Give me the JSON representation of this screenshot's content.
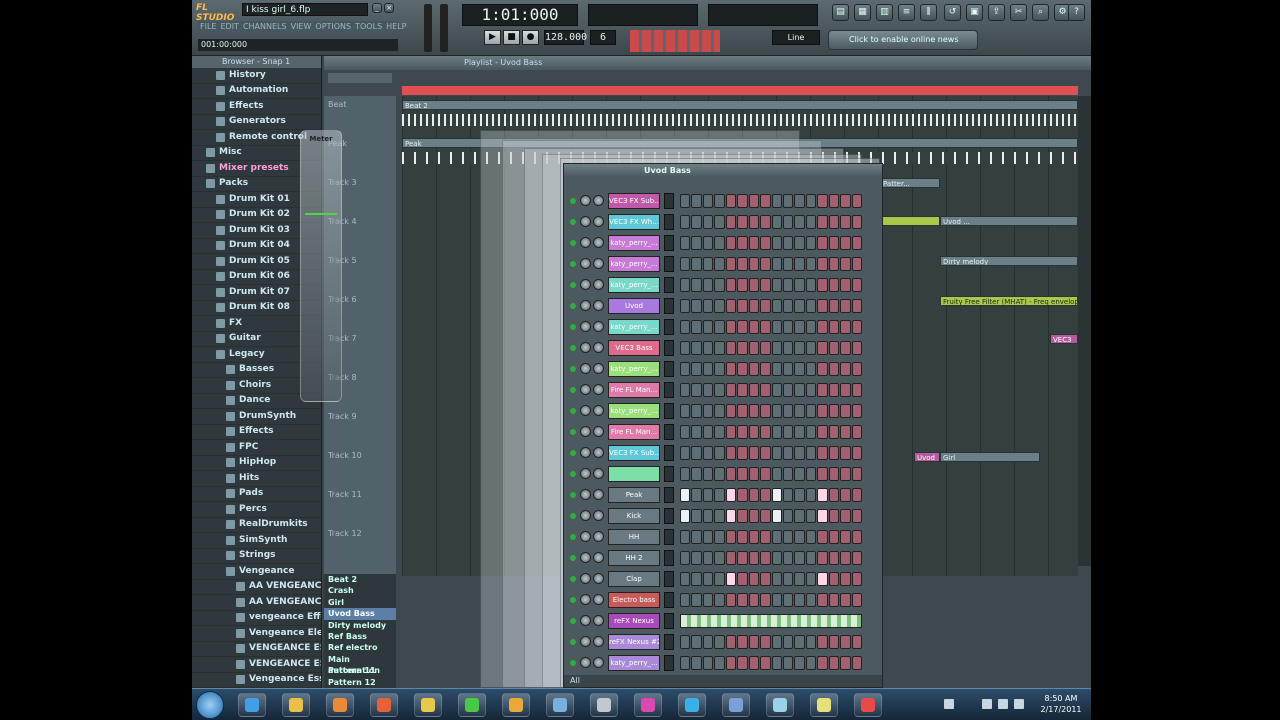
{
  "app": {
    "name": "FL STUDIO",
    "project_file": "I kiss girl_6.flp",
    "hint_time": "001:00:000",
    "menu": [
      "FILE",
      "EDIT",
      "CHANNELS",
      "VIEW",
      "OPTIONS",
      "TOOLS",
      "HELP"
    ],
    "song_time": "1:01:000",
    "tempo": "128.000",
    "pattern_number": "6",
    "snap": "Line",
    "news_label": "Click to enable online news"
  },
  "browser": {
    "title": "Browser - Snap 1",
    "items": [
      {
        "label": "History",
        "hl": false
      },
      {
        "label": "Automation",
        "hl": false
      },
      {
        "label": "Effects",
        "hl": false
      },
      {
        "label": "Generators",
        "hl": false
      },
      {
        "label": "Remote control",
        "hl": false
      },
      {
        "label": "Misc",
        "hl": false
      },
      {
        "label": "Mixer presets",
        "hl": true
      },
      {
        "label": "Packs",
        "hl": false
      },
      {
        "label": "Drum Kit 01",
        "hl": false
      },
      {
        "label": "Drum Kit 02",
        "hl": false
      },
      {
        "label": "Drum Kit 03",
        "hl": false
      },
      {
        "label": "Drum Kit 04",
        "hl": false
      },
      {
        "label": "Drum Kit 05",
        "hl": false
      },
      {
        "label": "Drum Kit 06",
        "hl": false
      },
      {
        "label": "Drum Kit 07",
        "hl": false
      },
      {
        "label": "Drum Kit 08",
        "hl": false
      },
      {
        "label": "FX",
        "hl": false
      },
      {
        "label": "Guitar",
        "hl": false
      },
      {
        "label": "Legacy",
        "hl": false
      },
      {
        "label": "Basses",
        "hl": false
      },
      {
        "label": "Choirs",
        "hl": false
      },
      {
        "label": "Dance",
        "hl": false
      },
      {
        "label": "DrumSynth",
        "hl": false
      },
      {
        "label": "Effects",
        "hl": false
      },
      {
        "label": "FPC",
        "hl": false
      },
      {
        "label": "HipHop",
        "hl": false
      },
      {
        "label": "Hits",
        "hl": false
      },
      {
        "label": "Pads",
        "hl": false
      },
      {
        "label": "Percs",
        "hl": false
      },
      {
        "label": "RealDrumkits",
        "hl": false
      },
      {
        "label": "SimSynth",
        "hl": false
      },
      {
        "label": "Strings",
        "hl": false
      },
      {
        "label": "Vengeance",
        "hl": false
      },
      {
        "label": "AA VENGEANCE ...",
        "hl": false
      },
      {
        "label": "AA VENGEANCE ...",
        "hl": false
      },
      {
        "label": "vengeance Effe...",
        "hl": false
      },
      {
        "label": "Vengeance Elec...",
        "hl": false
      },
      {
        "label": "VENGEANCE ES...",
        "hl": false
      },
      {
        "label": "VENGEANCE ES...",
        "hl": false
      },
      {
        "label": "Vengeance Ess...",
        "hl": false
      }
    ]
  },
  "playlist": {
    "title": "Playlist - Uvod Bass",
    "tracks": [
      "Beat",
      "Peak",
      "Track 3",
      "Track 4",
      "Track 5",
      "Track 6",
      "Track 7",
      "Track 8",
      "Track 9",
      "Track 10",
      "Track 11",
      "Track 12"
    ],
    "patterns": [
      {
        "label": "Beat 2",
        "sel": false
      },
      {
        "label": "Crash",
        "sel": false
      },
      {
        "label": "Girl",
        "sel": false
      },
      {
        "label": "Uvod Bass",
        "sel": true
      },
      {
        "label": "Dirty melody",
        "sel": false
      },
      {
        "label": "Ref Bass",
        "sel": false
      },
      {
        "label": "Ref electro",
        "sel": false
      },
      {
        "label": "Main automation",
        "sel": false
      },
      {
        "label": "Pattern 11",
        "sel": false
      },
      {
        "label": "Pattern 12",
        "sel": false
      }
    ],
    "clips": {
      "beat": "Beat",
      "beat2": "Beat 2",
      "peak": "Peak",
      "patter": "Patter...",
      "uvod": "Uvod ...",
      "dirty": "Dirty melody",
      "filter": "Fruity Free Filter (MHAT) - Freq envelope",
      "vec3": "VEC3",
      "uvod_small": "Uvod",
      "girl": "Girl"
    }
  },
  "meter": {
    "title": "Meter"
  },
  "sequencer": {
    "title": "Uvod Bass",
    "footer": "All",
    "channels": [
      {
        "name": "VEC3 FX Sub...",
        "color": "#c05aa8",
        "pattern": "0000000000000000"
      },
      {
        "name": "VEC3 FX Wh...",
        "color": "#5ec8d8",
        "pattern": "0000000000000000"
      },
      {
        "name": "katy_perry_...",
        "color": "#c87ad8",
        "pattern": "0000000000000000"
      },
      {
        "name": "katy_perry_...",
        "color": "#c87ad8",
        "pattern": "0000000000000000"
      },
      {
        "name": "katy_perry_...",
        "color": "#7ad8c8",
        "pattern": "0000000000000000"
      },
      {
        "name": "Uvod",
        "color": "#a87ae0",
        "pattern": "0000000000000000"
      },
      {
        "name": "katy_perry_...",
        "color": "#7ad8c8",
        "pattern": "0000000000000000"
      },
      {
        "name": "VEC3 Bass",
        "color": "#e06a8a",
        "pattern": "0000000000000000"
      },
      {
        "name": "katy_perry_...",
        "color": "#9ae07a",
        "pattern": "0000000000000000"
      },
      {
        "name": "Fire FL Man...",
        "color": "#e07aa8",
        "pattern": "0000000000000000"
      },
      {
        "name": "katy_perry_...",
        "color": "#9ae07a",
        "pattern": "0000000000000000"
      },
      {
        "name": "Fire FL Man...",
        "color": "#e07aa8",
        "pattern": "0000000000000000"
      },
      {
        "name": "VEC3 FX Sub...",
        "color": "#5ec8d8",
        "pattern": "0000000000000000"
      },
      {
        "name": "",
        "color": "#7ae0a8",
        "pattern": "0000000000000000"
      },
      {
        "name": "Peak",
        "color": "#6a7a82",
        "pattern": "1000100010001000"
      },
      {
        "name": "Kick",
        "color": "#6a7a82",
        "pattern": "1000100010001000"
      },
      {
        "name": "HH",
        "color": "#6a7a82",
        "pattern": "0000000000000000"
      },
      {
        "name": "HH 2",
        "color": "#6a7a82",
        "pattern": "0000000000000000"
      },
      {
        "name": "Clap",
        "color": "#6a7a82",
        "pattern": "0000100000001000"
      },
      {
        "name": "Electro bass",
        "color": "#c85a5a",
        "pattern": "0000000000000000"
      },
      {
        "name": "reFX Nexus",
        "color": "#a84ab8",
        "pattern": "roll"
      },
      {
        "name": "reFX Nexus #2",
        "color": "#a88ad8",
        "pattern": "0000000000000000"
      },
      {
        "name": "katy_perry_...",
        "color": "#a88ad8",
        "pattern": "0000000000000000"
      }
    ]
  },
  "taskbar": {
    "time": "8:50 AM",
    "date": "2/17/2011",
    "icons": [
      {
        "name": "ie-icon",
        "color": "#3fa0e8"
      },
      {
        "name": "explorer-icon",
        "color": "#e8c04a"
      },
      {
        "name": "media-player-icon",
        "color": "#e88a3a"
      },
      {
        "name": "firefox-icon",
        "color": "#e8603a"
      },
      {
        "name": "fl-studio-icon",
        "color": "#e8c84a"
      },
      {
        "name": "utorrent-icon",
        "color": "#4ac84a"
      },
      {
        "name": "globe-icon",
        "color": "#e8a83a"
      },
      {
        "name": "window-icon",
        "color": "#7ab0e0"
      },
      {
        "name": "disc-icon",
        "color": "#c0c8d0"
      },
      {
        "name": "itunes-icon",
        "color": "#d84ab0"
      },
      {
        "name": "skype-icon",
        "color": "#3ab0e8"
      },
      {
        "name": "control-panel-icon",
        "color": "#7aa0d8"
      },
      {
        "name": "recycle-icon",
        "color": "#9ad0e8"
      },
      {
        "name": "notes-icon",
        "color": "#e8e07a"
      },
      {
        "name": "fl-taskbar-icon",
        "color": "#e84a4a"
      }
    ]
  }
}
